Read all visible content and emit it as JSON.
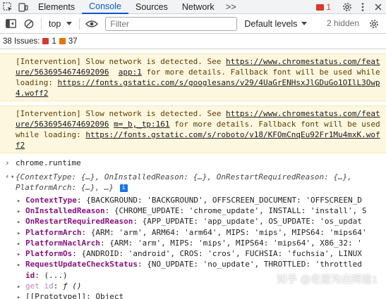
{
  "tabs": [
    "Elements",
    "Console",
    "Sources",
    "Network"
  ],
  "active_tab": "Console",
  "more_tabs": ">>",
  "error_count": "1",
  "toolbar": {
    "context": "top",
    "filter_placeholder": "Filter",
    "levels": "Default levels",
    "hidden": "2 hidden"
  },
  "issues": {
    "label": "38 Issues:",
    "errors": "1",
    "warnings": "37"
  },
  "messages": [
    {
      "pre": "[Intervention] Slow network is detected. See ",
      "link": "https://www.chromestatus.com/feature/5636954674692096",
      "source": "app:1",
      "mid": " for more details. Fallback font will be used while loading: ",
      "font": "https://fonts.gstatic.com/s/googlesans/v29/4UaGrENHsxJlGDuGo1OIlL3Owp4.woff2"
    },
    {
      "pre": "[Intervention] Slow network is detected. See ",
      "link": "https://www.chromestatus.com/feature/5636954674692096",
      "source": "m=_b,_tp:161",
      "mid": " for more details. Fallback font will be used while loading: ",
      "font": "https://fonts.gstatic.com/s/roboto/v18/KFOmCnqEu92Fr1Mu4mxK.woff2"
    }
  ],
  "input_command": "chrome.runtime",
  "result_summary": "{ContextType: {…}, OnInstalledReason: {…}, OnRestartRequiredReason: {…}, PlatformArch: {…}, …}",
  "properties": [
    {
      "key": "ContextType",
      "value": "{BACKGROUND: 'BACKGROUND', OFFSCREEN_DOCUMENT: 'OFFSCREEN_D"
    },
    {
      "key": "OnInstalledReason",
      "value": "{CHROME_UPDATE: 'chrome_update', INSTALL: 'install', S"
    },
    {
      "key": "OnRestartRequiredReason",
      "value": "{APP_UPDATE: 'app_update', OS_UPDATE: 'os_updat"
    },
    {
      "key": "PlatformArch",
      "value": "{ARM: 'arm', ARM64: 'arm64', MIPS: 'mips', MIPS64: 'mips64'"
    },
    {
      "key": "PlatformNaclArch",
      "value": "{ARM: 'arm', MIPS: 'mips', MIPS64: 'mips64', X86_32: '"
    },
    {
      "key": "PlatformOs",
      "value": "{ANDROID: 'android', CROS: 'cros', FUCHSIA: 'fuchsia', LINUX"
    },
    {
      "key": "RequestUpdateCheckStatus",
      "value": "{NO_UPDATE: 'no_update', THROTTLED: 'throttled"
    }
  ],
  "id_row": {
    "key": "id",
    "value": "(...)"
  },
  "getter_row": {
    "key": "get id",
    "value": "ƒ ()"
  },
  "proto_row": {
    "key": "[[Prototype]]",
    "value": "Object"
  },
  "watermark": "知乎 @老屋沟出辉煌1"
}
